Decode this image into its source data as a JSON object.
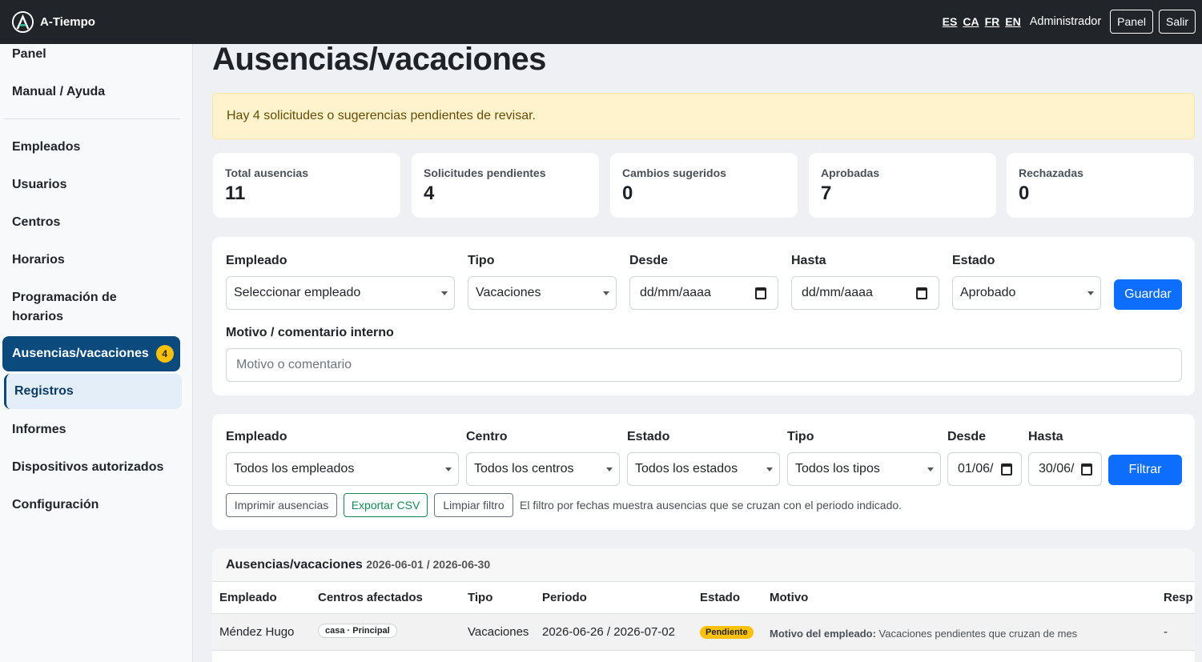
{
  "topbar": {
    "brand": "A-Tiempo",
    "languages": [
      "ES",
      "CA",
      "FR",
      "EN"
    ],
    "user": "Administrador",
    "panel_button": "Panel",
    "logout_button": "Salir"
  },
  "sidebar": {
    "items": [
      "Panel",
      "Manual / Ayuda",
      "Empleados",
      "Usuarios",
      "Centros",
      "Horarios",
      "Programación de",
      "horarios",
      "Ausencias/vacaciones",
      "Registros",
      "Informes",
      "Dispositivos autorizados",
      "Configuración"
    ],
    "active_badge": "4"
  },
  "page": {
    "title": "Ausencias/vacaciones",
    "alert": "Hay 4 solicitudes o sugerencias pendientes de revisar."
  },
  "stats": [
    {
      "label": "Total ausencias",
      "value": "11"
    },
    {
      "label": "Solicitudes pendientes",
      "value": "4"
    },
    {
      "label": "Cambios sugeridos",
      "value": "0"
    },
    {
      "label": "Aprobadas",
      "value": "7"
    },
    {
      "label": "Rechazadas",
      "value": "0"
    }
  ],
  "form": {
    "employee_label": "Empleado",
    "employee_value": "Seleccionar empleado",
    "type_label": "Tipo",
    "type_value": "Vacaciones",
    "from_label": "Desde",
    "from_value": "dd/mm/aaaa",
    "to_label": "Hasta",
    "to_value": "dd/mm/aaaa",
    "status_label": "Estado",
    "status_value": "Aprobado",
    "save_button": "Guardar",
    "comment_label": "Motivo / comentario interno",
    "comment_placeholder": "Motivo o comentario"
  },
  "filters": {
    "employee_label": "Empleado",
    "employee_value": "Todos los empleados",
    "center_label": "Centro",
    "center_value": "Todos los centros",
    "status_label": "Estado",
    "status_value": "Todos los estados",
    "type_label": "Tipo",
    "type_value": "Todos los tipos",
    "from_label": "Desde",
    "from_value": "01/06/",
    "to_label": "Hasta",
    "to_value": "30/06/",
    "filter_button": "Filtrar",
    "print_button": "Imprimir ausencias",
    "export_button": "Exportar CSV",
    "clear_button": "Limpiar filtro",
    "note": "El filtro por fechas muestra ausencias que se cruzan con el periodo indicado."
  },
  "table": {
    "title": "Ausencias/vacaciones",
    "range": "2026-06-01 / 2026-06-30",
    "columns": [
      "Empleado",
      "Centros afectados",
      "Tipo",
      "Periodo",
      "Estado",
      "Motivo",
      "Resp"
    ],
    "rows": [
      {
        "employee": "Méndez Hugo",
        "centers": "casa · Principal",
        "type": "Vacaciones",
        "period": "2026-06-26 / 2026-07-02",
        "status": "Pendiente",
        "reason_label": "Motivo del empleado:",
        "reason": "Vacaciones pendientes que cruzan de mes",
        "response": "-"
      }
    ]
  },
  "colors": {
    "topbar": "#212529",
    "accent": "#0b4a7c",
    "primary": "#0d6efd",
    "badge": "#ffc107",
    "alert_bg": "#fff3cd"
  }
}
